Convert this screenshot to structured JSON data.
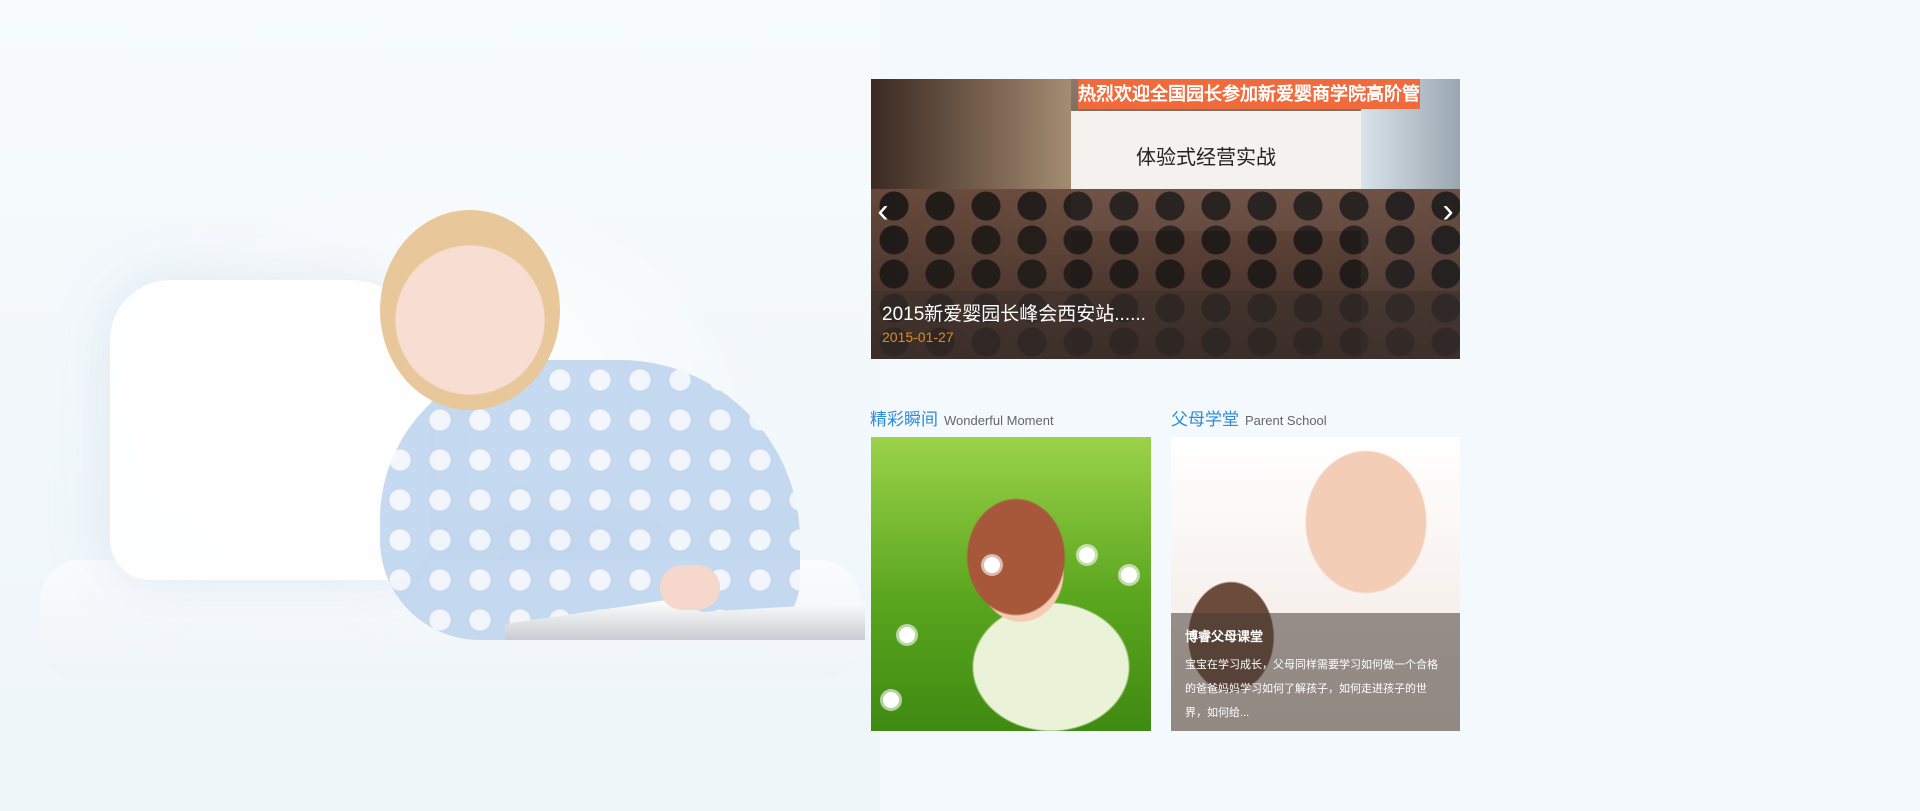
{
  "header": {
    "faint_text_1": "",
    "faint_text_2": "",
    "faint_text_3": "",
    "faint_text_4": ""
  },
  "slider": {
    "banner_text": "热烈欢迎全国园长参加新爱婴商学院高阶管理培训！",
    "board_title": "体验式经营实战",
    "slide_title": "2015新爱婴园长峰会西安站......",
    "slide_date": "2015-01-27",
    "prev_label": "‹",
    "next_label": "›"
  },
  "sections": [
    {
      "title_cn": "精彩瞬间",
      "title_en": "Wonderful Moment"
    },
    {
      "title_cn": "父母学堂",
      "title_en": "Parent School"
    }
  ],
  "parent_school_card": {
    "title": "博睿父母课堂",
    "description": "宝宝在学习成长，父母同样需要学习如何做一个合格的爸爸妈妈学习如何了解孩子，如何走进孩子的世界，如何给..."
  },
  "colors": {
    "accent": "#2f8bd8",
    "date": "#e18a1f",
    "page_background": "#f3f9fc"
  }
}
